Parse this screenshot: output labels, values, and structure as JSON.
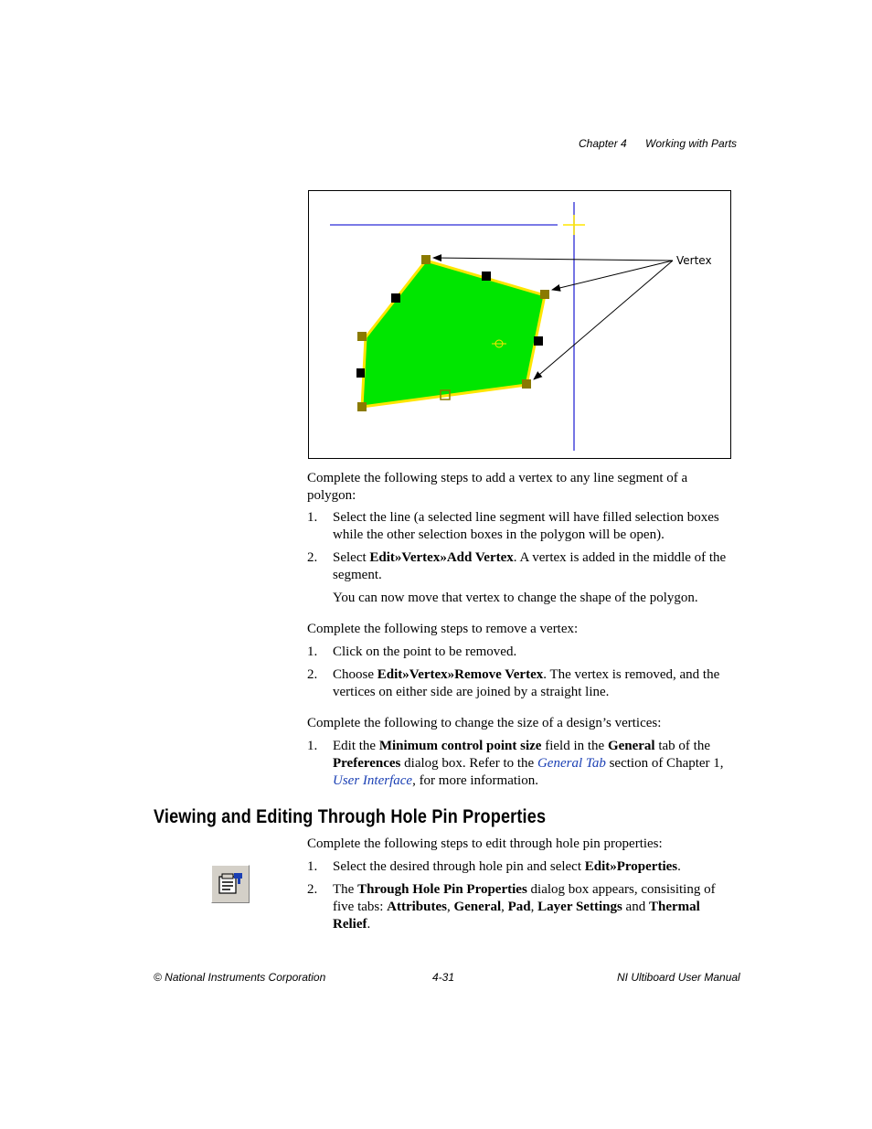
{
  "header": {
    "chapter": "Chapter 4",
    "title": "Working with Parts"
  },
  "figure": {
    "callout_label": "Vertex"
  },
  "section1": {
    "intro": "Complete the following steps to add a vertex to any line segment of a polygon:",
    "steps": [
      {
        "num": "1.",
        "text": "Select the line (a selected line segment will have filled selection boxes while the other selection boxes in the polygon will be open)."
      },
      {
        "num": "2.",
        "pre": "Select ",
        "bold": "Edit»Vertex»Add Vertex",
        "post": ". A vertex is added in the middle of the segment."
      }
    ],
    "note": "You can now move that vertex to change the shape of the polygon."
  },
  "section2": {
    "intro": "Complete the following steps to remove a vertex:",
    "steps": [
      {
        "num": "1.",
        "text": "Click on the point to be removed."
      },
      {
        "num": "2.",
        "pre": "Choose ",
        "bold": "Edit»Vertex»Remove Vertex",
        "post": ". The vertex is removed, and the vertices on either side are joined by a straight line."
      }
    ]
  },
  "section3": {
    "intro": "Complete the following to change the size of a design’s vertices:",
    "step": {
      "num": "1.",
      "p1": "Edit the ",
      "b1": "Minimum control point size",
      "p2": " field in the ",
      "b2": "General",
      "p3": " tab of the ",
      "b3": "Preferences",
      "p4": " dialog box. Refer to the ",
      "link1": "General Tab",
      "p5": " section of Chapter 1, ",
      "link2": "User Interface",
      "p6": ", for more information."
    }
  },
  "heading": "Viewing and Editing Through Hole Pin Properties",
  "section4": {
    "intro": "Complete the following steps to edit through hole pin properties:",
    "step1": {
      "num": "1.",
      "pre": "Select the desired through hole pin and select ",
      "bold": "Edit»Properties",
      "post": "."
    },
    "step2": {
      "num": "2.",
      "p1": "The ",
      "b1": "Through Hole Pin Properties",
      "p2": " dialog box appears, consisiting of five tabs: ",
      "b2": "Attributes",
      "c1": ", ",
      "b3": "General",
      "c2": ", ",
      "b4": "Pad",
      "c3": ", ",
      "b5": "Layer Settings",
      "p3": " and ",
      "b6": "Thermal Relief",
      "p4": "."
    },
    "icon": "properties-toolbar-icon"
  },
  "footer": {
    "left": "© National Instruments Corporation",
    "center": "4-31",
    "right": "NI Ultiboard User Manual"
  }
}
